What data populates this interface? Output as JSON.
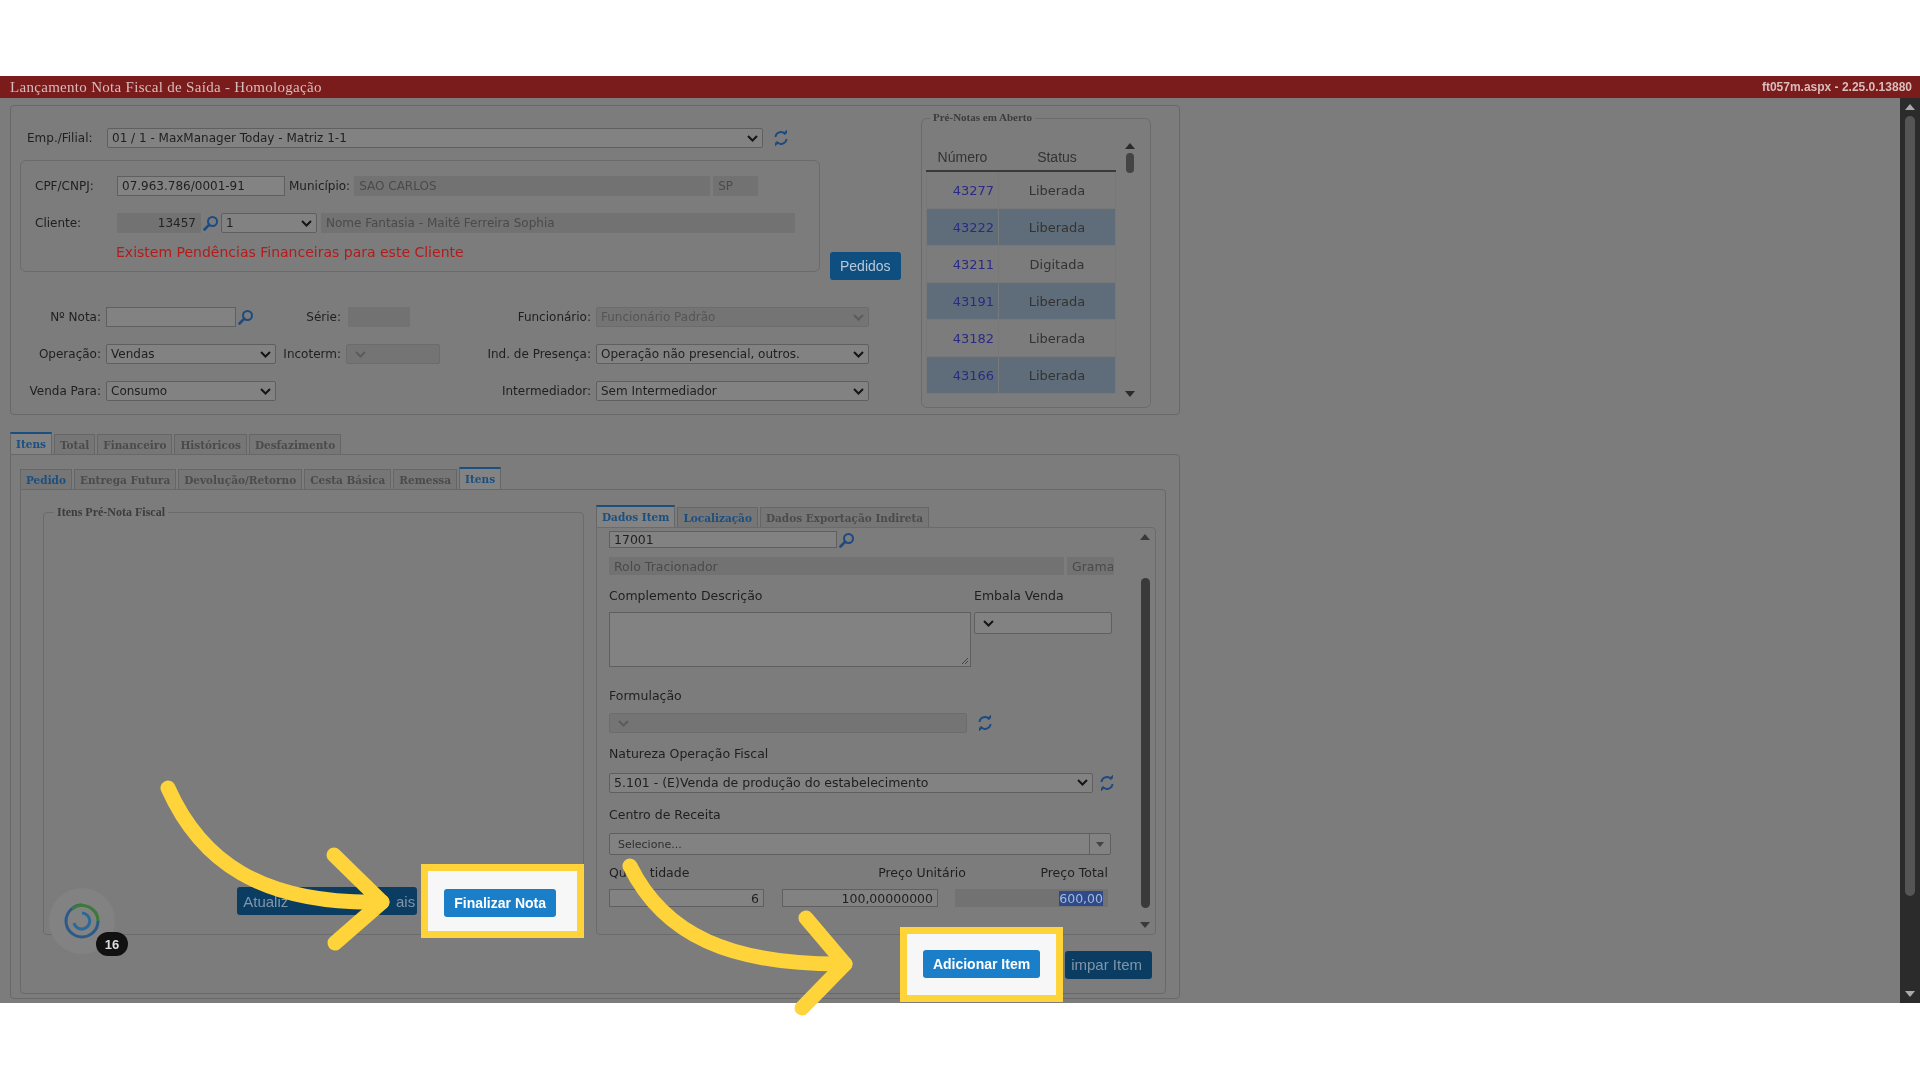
{
  "window": {
    "title": "Lançamento Nota Fiscal de Saída  - Homologação",
    "version": "ft057m.aspx - 2.25.0.13880"
  },
  "emp_filial": {
    "label": "Emp./Filial:",
    "value": "01 / 1 - MaxManager Today - Matriz 1-1",
    "disabled": false
  },
  "client": {
    "cpf_label": "CPF/CNPJ:",
    "cpf": "07.963.786/0001-91",
    "municipio_label": "Município:",
    "municipio": "SAO CARLOS",
    "uf": "SP",
    "cliente_label": "Cliente:",
    "code": "13457",
    "loja": "1",
    "fantasia": "Nome Fantasia - Maitê Ferreira Sophia",
    "warning": "Existem Pendências Financeiras para este Cliente"
  },
  "pedidos_button": "Pedidos",
  "nota": {
    "label": "Nº Nota:",
    "serie_label": "Série:"
  },
  "funcionario": {
    "label": "Funcionário:",
    "value": "Funcionário Padrão",
    "disabled": true
  },
  "operacao": {
    "label": "Operação:",
    "value": "Vendas",
    "disabled": false
  },
  "incoterm": {
    "label": "Incoterm:",
    "disabled": true
  },
  "presenca": {
    "label": "Ind. de Presença:",
    "value": "Operação não presencial, outros.",
    "disabled": false
  },
  "venda_para": {
    "label": "Venda Para:",
    "value": "Consumo",
    "disabled": false
  },
  "intermediador": {
    "label": "Intermediador:",
    "value": "Sem Intermediador",
    "disabled": false
  },
  "pre_notas": {
    "title": "Pré-Notas em Aberto",
    "columns": [
      "Número",
      "Status"
    ],
    "rows": [
      {
        "numero": "43277",
        "status": "Liberada"
      },
      {
        "numero": "43222",
        "status": "Liberada"
      },
      {
        "numero": "43211",
        "status": "Digitada"
      },
      {
        "numero": "43191",
        "status": "Liberada"
      },
      {
        "numero": "43182",
        "status": "Liberada"
      },
      {
        "numero": "43166",
        "status": "Liberada"
      }
    ]
  },
  "tabs": [
    {
      "label": "Itens",
      "selected": true
    },
    {
      "label": "Total",
      "selected": false
    },
    {
      "label": "Financeiro",
      "selected": false
    },
    {
      "label": "Históricos",
      "selected": false
    },
    {
      "label": "Desfazimento",
      "selected": false
    }
  ],
  "subtabs": [
    {
      "label": "Pedido",
      "selected": false,
      "highlighted": true
    },
    {
      "label": "Entrega Futura",
      "selected": false,
      "highlighted": false
    },
    {
      "label": "Devolução/Retorno",
      "selected": false,
      "highlighted": false
    },
    {
      "label": "Cesta Básica",
      "selected": false,
      "highlighted": false
    },
    {
      "label": "Remessa",
      "selected": false,
      "highlighted": false
    },
    {
      "label": "Itens",
      "selected": true,
      "highlighted": true
    }
  ],
  "item_tabs": [
    {
      "label": "Dados Item",
      "selected": true,
      "highlighted": true
    },
    {
      "label": "Localização",
      "selected": false,
      "highlighted": true
    },
    {
      "label": "Dados Exportação Indireta",
      "selected": false,
      "highlighted": false
    }
  ],
  "items_fieldset": {
    "title": "Itens Pré-Nota Fiscal"
  },
  "item": {
    "code": "17001",
    "description": "Rolo Tracionador",
    "unit": "Grama",
    "complemento_label": "Complemento Descrição",
    "embala_label": "Embala Venda",
    "formulacao": {
      "label": "Formulação",
      "disabled": true
    },
    "natureza": {
      "label": "Natureza Operação Fiscal",
      "value": "5.101 - (E)Venda de produção do estabelecimento",
      "disabled": false
    },
    "centro": {
      "label": "Centro de Receita",
      "placeholder": "Selecione..."
    },
    "quantidade": {
      "label_start": "Qu",
      "label_end": "tidade",
      "value": "6"
    },
    "preco_unitario": {
      "label": "Preço Unitário",
      "value": "100,00000000"
    },
    "preco_total": {
      "label": "Preço Total",
      "value": "600,00",
      "text_selected": true
    }
  },
  "buttons": {
    "atualizar_start": "Atualiz",
    "atualizar_end": "ais",
    "finalizar": "Finalizar Nota",
    "adicionar": "Adicionar Item",
    "limpar": "impar Item"
  },
  "badge": "16"
}
